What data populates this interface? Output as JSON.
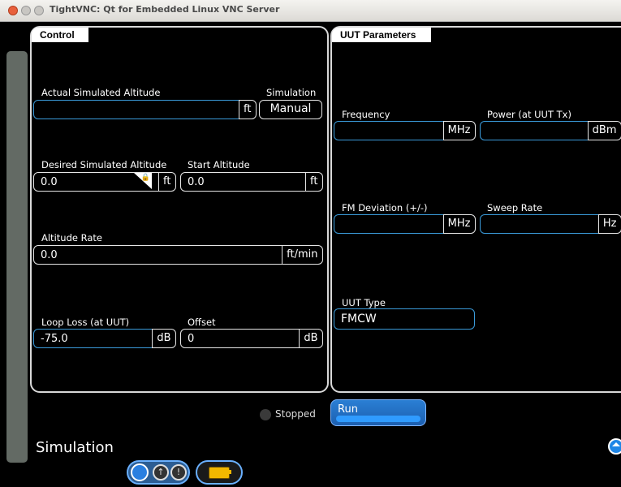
{
  "window": {
    "title": "TightVNC: Qt for Embedded Linux VNC Server"
  },
  "control": {
    "tab": "Control",
    "actual_altitude": {
      "label": "Actual Simulated Altitude",
      "value": "",
      "unit": "ft"
    },
    "simulation_mode": {
      "label": "Simulation",
      "value": "Manual"
    },
    "desired_altitude": {
      "label": "Desired Simulated Altitude",
      "value": "0.0",
      "unit": "ft"
    },
    "start_altitude": {
      "label": "Start Altitude",
      "value": "0.0",
      "unit": "ft"
    },
    "altitude_rate": {
      "label": "Altitude Rate",
      "value": "0.0",
      "unit": "ft/min"
    },
    "loop_loss": {
      "label": "Loop Loss (at UUT)",
      "value": "-75.0",
      "unit": "dB"
    },
    "offset": {
      "label": "Offset",
      "value": "0",
      "unit": "dB"
    }
  },
  "uut": {
    "tab": "UUT Parameters",
    "frequency": {
      "label": "Frequency",
      "value": "",
      "unit": "MHz"
    },
    "power": {
      "label": "Power (at UUT Tx)",
      "value": "",
      "unit": "dBm"
    },
    "fm_deviation": {
      "label": "FM Deviation (+/-)",
      "value": "",
      "unit": "MHz"
    },
    "sweep_rate": {
      "label": "Sweep Rate",
      "value": "",
      "unit": "Hz"
    },
    "uut_type": {
      "label": "UUT Type",
      "value": "FMCW"
    }
  },
  "status": {
    "text": "Stopped"
  },
  "run_button": {
    "label": "Run"
  },
  "footer": {
    "title": "Simulation"
  },
  "icons": {
    "power": "power-icon",
    "info": "info-icon",
    "alert": "alert-icon",
    "battery": "battery-icon",
    "eject": "eject-icon",
    "lock": "lock-icon"
  },
  "colors": {
    "accent": "#3a9ad9",
    "run": "#1f6fc4",
    "background": "#000000"
  }
}
